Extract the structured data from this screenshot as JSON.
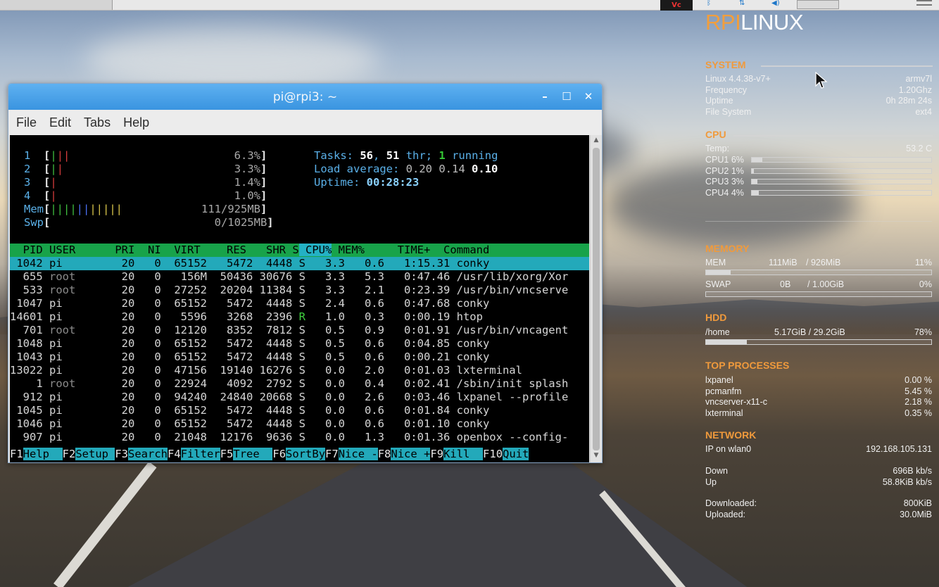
{
  "window": {
    "title": "pi@rpi3: ~",
    "menu": [
      "File",
      "Edit",
      "Tabs",
      "Help"
    ]
  },
  "htop": {
    "cpus": [
      {
        "label": "1",
        "pct": "6.3%"
      },
      {
        "label": "2",
        "pct": "3.3%"
      },
      {
        "label": "3",
        "pct": "1.4%"
      },
      {
        "label": "4",
        "pct": "1.0%"
      }
    ],
    "mem": {
      "label": "Mem",
      "value": "111/925MB"
    },
    "swp": {
      "label": "Swp",
      "value": "0/1025MB"
    },
    "tasks": {
      "label": "Tasks:",
      "count": "56",
      "sep": ",",
      "thr": "51",
      "thr_label": "thr;",
      "running": "1",
      "running_label": "running"
    },
    "load": {
      "label": "Load average:",
      "v1": "0.20",
      "v2": "0.14",
      "v3": "0.10"
    },
    "uptime": {
      "label": "Uptime:",
      "value": "00:28:23"
    },
    "columns": [
      "PID",
      "USER",
      "PRI",
      "NI",
      "VIRT",
      "RES",
      "SHR",
      "S",
      "CPU%",
      "MEM%",
      "TIME+",
      "Command"
    ],
    "processes": [
      {
        "pid": "1042",
        "user": "pi",
        "pri": "20",
        "ni": "0",
        "virt": "65152",
        "res": "5472",
        "shr": "4448",
        "s": "S",
        "cpu": "3.3",
        "mem": "0.6",
        "time": "1:15.31",
        "cmd": "conky"
      },
      {
        "pid": "655",
        "user": "root",
        "pri": "20",
        "ni": "0",
        "virt": "156M",
        "res": "50436",
        "shr": "30676",
        "s": "S",
        "cpu": "3.3",
        "mem": "5.3",
        "time": "0:47.46",
        "cmd": "/usr/lib/xorg/Xor"
      },
      {
        "pid": "533",
        "user": "root",
        "pri": "20",
        "ni": "0",
        "virt": "27252",
        "res": "20204",
        "shr": "11384",
        "s": "S",
        "cpu": "3.3",
        "mem": "2.1",
        "time": "0:23.39",
        "cmd": "/usr/bin/vncserve"
      },
      {
        "pid": "1047",
        "user": "pi",
        "pri": "20",
        "ni": "0",
        "virt": "65152",
        "res": "5472",
        "shr": "4448",
        "s": "S",
        "cpu": "2.4",
        "mem": "0.6",
        "time": "0:47.68",
        "cmd": "conky"
      },
      {
        "pid": "14601",
        "user": "pi",
        "pri": "20",
        "ni": "0",
        "virt": "5596",
        "res": "3268",
        "shr": "2396",
        "s": "R",
        "cpu": "1.0",
        "mem": "0.3",
        "time": "0:00.19",
        "cmd": "htop"
      },
      {
        "pid": "701",
        "user": "root",
        "pri": "20",
        "ni": "0",
        "virt": "12120",
        "res": "8352",
        "shr": "7812",
        "s": "S",
        "cpu": "0.5",
        "mem": "0.9",
        "time": "0:01.91",
        "cmd": "/usr/bin/vncagent"
      },
      {
        "pid": "1048",
        "user": "pi",
        "pri": "20",
        "ni": "0",
        "virt": "65152",
        "res": "5472",
        "shr": "4448",
        "s": "S",
        "cpu": "0.5",
        "mem": "0.6",
        "time": "0:04.85",
        "cmd": "conky"
      },
      {
        "pid": "1043",
        "user": "pi",
        "pri": "20",
        "ni": "0",
        "virt": "65152",
        "res": "5472",
        "shr": "4448",
        "s": "S",
        "cpu": "0.5",
        "mem": "0.6",
        "time": "0:00.21",
        "cmd": "conky"
      },
      {
        "pid": "13022",
        "user": "pi",
        "pri": "20",
        "ni": "0",
        "virt": "47156",
        "res": "19140",
        "shr": "16276",
        "s": "S",
        "cpu": "0.0",
        "mem": "2.0",
        "time": "0:01.03",
        "cmd": "lxterminal"
      },
      {
        "pid": "1",
        "user": "root",
        "pri": "20",
        "ni": "0",
        "virt": "22924",
        "res": "4092",
        "shr": "2792",
        "s": "S",
        "cpu": "0.0",
        "mem": "0.4",
        "time": "0:02.41",
        "cmd": "/sbin/init splash"
      },
      {
        "pid": "912",
        "user": "pi",
        "pri": "20",
        "ni": "0",
        "virt": "94240",
        "res": "24840",
        "shr": "20668",
        "s": "S",
        "cpu": "0.0",
        "mem": "2.6",
        "time": "0:03.46",
        "cmd": "lxpanel --profile"
      },
      {
        "pid": "1045",
        "user": "pi",
        "pri": "20",
        "ni": "0",
        "virt": "65152",
        "res": "5472",
        "shr": "4448",
        "s": "S",
        "cpu": "0.0",
        "mem": "0.6",
        "time": "0:01.84",
        "cmd": "conky"
      },
      {
        "pid": "1046",
        "user": "pi",
        "pri": "20",
        "ni": "0",
        "virt": "65152",
        "res": "5472",
        "shr": "4448",
        "s": "S",
        "cpu": "0.0",
        "mem": "0.6",
        "time": "0:01.10",
        "cmd": "conky"
      },
      {
        "pid": "907",
        "user": "pi",
        "pri": "20",
        "ni": "0",
        "virt": "21048",
        "res": "12176",
        "shr": "9636",
        "s": "S",
        "cpu": "0.0",
        "mem": "1.3",
        "time": "0:01.36",
        "cmd": "openbox --config-"
      }
    ],
    "fkeys": [
      {
        "key": "F1",
        "label": "Help  "
      },
      {
        "key": "F2",
        "label": "Setup "
      },
      {
        "key": "F3",
        "label": "Search"
      },
      {
        "key": "F4",
        "label": "Filter"
      },
      {
        "key": "F5",
        "label": "Tree  "
      },
      {
        "key": "F6",
        "label": "SortBy"
      },
      {
        "key": "F7",
        "label": "Nice -"
      },
      {
        "key": "F8",
        "label": "Nice +"
      },
      {
        "key": "F9",
        "label": "Kill  "
      },
      {
        "key": "F10",
        "label": "Quit"
      }
    ]
  },
  "conky": {
    "brand_a": "RPI",
    "brand_b": "LINUX",
    "system": {
      "title": "SYSTEM",
      "rows": [
        {
          "k": "Linux 4.4.38-v7+",
          "v": "armv7l"
        },
        {
          "k": "Frequency",
          "v": "1.20Ghz"
        },
        {
          "k": "Uptime",
          "v": "0h 28m 24s"
        },
        {
          "k": "File System",
          "v": "ext4"
        }
      ]
    },
    "cpu": {
      "title": "CPU",
      "temp_label": "Temp:",
      "temp_value": "53.2 C",
      "cores": [
        {
          "label": "CPU1",
          "pct": "6%",
          "fill": 0.06
        },
        {
          "label": "CPU2",
          "pct": "1%",
          "fill": 0.01
        },
        {
          "label": "CPU3",
          "pct": "3%",
          "fill": 0.03
        },
        {
          "label": "CPU4",
          "pct": "4%",
          "fill": 0.04
        }
      ]
    },
    "memory": {
      "title": "MEMORY",
      "mem": {
        "label": "MEM",
        "used": "111MiB",
        "total": "/ 926MiB",
        "pct": "11%",
        "fill": 0.11
      },
      "swap": {
        "label": "SWAP",
        "used": "0B",
        "total": "/ 1.00GiB",
        "pct": "0%",
        "fill": 0.0
      }
    },
    "hdd": {
      "title": "HDD",
      "label": "/home",
      "used": "5.17GiB / 29.2GiB",
      "pct": "78%",
      "fill": 0.18
    },
    "top": {
      "title": "TOP PROCESSES",
      "rows": [
        {
          "k": "lxpanel",
          "v": "0.00 %"
        },
        {
          "k": "pcmanfm",
          "v": "5.45 %"
        },
        {
          "k": "vncserver-x11-c",
          "v": "2.18 %"
        },
        {
          "k": "lxterminal",
          "v": "0.35 %"
        }
      ]
    },
    "network": {
      "title": "NETWORK",
      "ip_label": "IP on wlan0",
      "ip_value": "192.168.105.131",
      "down_label": "Down",
      "down_value": "696B   kb/s",
      "up_label": "Up",
      "up_value": "58.8KiB kb/s",
      "downloaded_label": "Downloaded:",
      "downloaded_value": "800KiB",
      "uploaded_label": "Uploaded:",
      "uploaded_value": "30.0MiB"
    }
  }
}
